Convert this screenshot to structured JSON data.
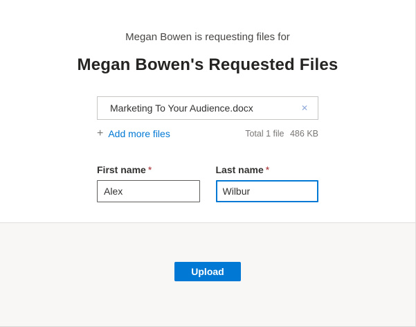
{
  "header": {
    "subtitle": "Megan Bowen is requesting files for",
    "title": "Megan Bowen's Requested Files"
  },
  "files": {
    "items": [
      {
        "name": "Marketing To Your Audience.docx"
      }
    ],
    "remove_glyph": "✕",
    "plus_glyph": "+",
    "add_more_label": "Add more files",
    "total_label": "Total 1 file",
    "total_size": "486 KB"
  },
  "form": {
    "first_name": {
      "label": "First name",
      "required_mark": "*",
      "value": "Alex"
    },
    "last_name": {
      "label": "Last name",
      "required_mark": "*",
      "value": "Wilbur"
    }
  },
  "footer": {
    "upload_label": "Upload"
  },
  "colors": {
    "accent": "#0078d4",
    "required": "#a4262c",
    "footer_background": "#f8f7f6",
    "close_icon": "#8fa9da"
  }
}
